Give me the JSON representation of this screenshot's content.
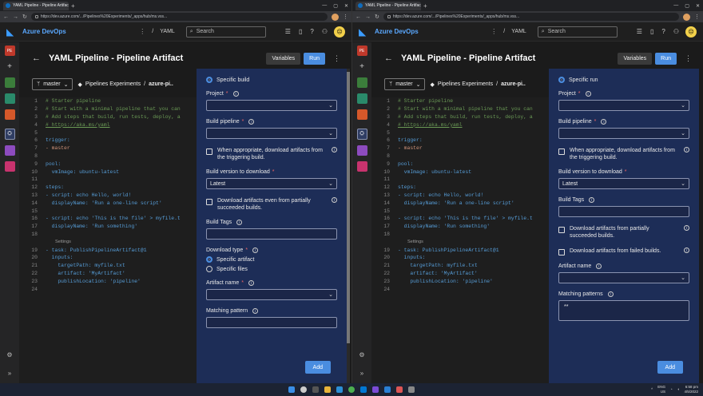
{
  "browser": {
    "tab_title": "YAML Pipeline - Pipeline Artifac",
    "url": "https://dev.azure.com/.../Pipelines%20Experiments/_apps/hub/ms.vss..."
  },
  "header": {
    "brand": "Azure DevOps",
    "crumb": "YAML",
    "search_placeholder": "Search",
    "avatar": "☹"
  },
  "rail": {
    "project_initials": "PE"
  },
  "page": {
    "title": "YAML Pipeline - Pipeline Artifact",
    "variables_label": "Variables",
    "run_label": "Run",
    "branch": "master",
    "repo_project": "Pipelines Experiments",
    "repo_file": "azure-pi.."
  },
  "editor": {
    "lines": [
      {
        "n": "1",
        "t": "# Starter pipeline",
        "k": "com"
      },
      {
        "n": "2",
        "t": "# Start with a minimal pipeline that you can",
        "k": "com"
      },
      {
        "n": "3",
        "t": "# Add steps that build, run tests, deploy, a",
        "k": "com"
      },
      {
        "n": "4",
        "t": "# https://aka.ms/yaml",
        "k": "link"
      },
      {
        "n": "5",
        "t": "",
        "k": "val"
      },
      {
        "n": "6",
        "t": "trigger:",
        "k": "key"
      },
      {
        "n": "7",
        "t": "- master",
        "k": "str"
      },
      {
        "n": "8",
        "t": "",
        "k": "val"
      },
      {
        "n": "9",
        "t": "pool:",
        "k": "key"
      },
      {
        "n": "10",
        "t": "  vmImage: ubuntu-latest",
        "k": "key"
      },
      {
        "n": "11",
        "t": "",
        "k": "val"
      },
      {
        "n": "12",
        "t": "steps:",
        "k": "key"
      },
      {
        "n": "13",
        "t": "- script: echo Hello, world!",
        "k": "key"
      },
      {
        "n": "14",
        "t": "  displayName: 'Run a one-line script'",
        "k": "key"
      },
      {
        "n": "15",
        "t": "",
        "k": "val"
      },
      {
        "n": "16",
        "t": "- script: echo 'This is the file' > myfile.t",
        "k": "key"
      },
      {
        "n": "17",
        "t": "  displayName: 'Run something'",
        "k": "key"
      },
      {
        "n": "18",
        "t": "",
        "k": "val"
      },
      {
        "n": "",
        "t": "Settings",
        "k": "lens"
      },
      {
        "n": "19",
        "t": "- task: PublishPipelineArtifact@1",
        "k": "key"
      },
      {
        "n": "20",
        "t": "  inputs:",
        "k": "key"
      },
      {
        "n": "21",
        "t": "    targetPath: myfile.txt",
        "k": "key"
      },
      {
        "n": "22",
        "t": "    artifact: 'MyArtifact'",
        "k": "key"
      },
      {
        "n": "23",
        "t": "    publishLocation: 'pipeline'",
        "k": "key"
      },
      {
        "n": "24",
        "t": "",
        "k": "val"
      }
    ]
  },
  "left_panel": {
    "top_radio": "Specific build",
    "project_label": "Project",
    "build_pipeline_label": "Build pipeline",
    "chk_trigger": "When appropriate, download artifacts from the triggering build.",
    "build_version_label": "Build version to download",
    "build_version_value": "Latest",
    "chk_partial": "Download artifacts even from partially succeeded builds.",
    "build_tags_label": "Build Tags",
    "download_type_label": "Download type",
    "radio_specific_artifact": "Specific artifact",
    "radio_specific_files": "Specific files",
    "artifact_name_label": "Artifact name",
    "matching_pattern_label": "Matching pattern",
    "add_label": "Add"
  },
  "right_panel": {
    "top_radio": "Specific run",
    "project_label": "Project",
    "build_pipeline_label": "Build pipeline",
    "chk_trigger": "When appropriate, download artifacts from the triggering build.",
    "build_version_label": "Build version to download",
    "build_version_value": "Latest",
    "build_tags_label": "Build Tags",
    "chk_partial": "Download artifacts from partially succeeded builds.",
    "chk_failed": "Download artifacts from failed builds.",
    "artifact_name_label": "Artifact name",
    "matching_patterns_label": "Matching patterns",
    "matching_patterns_value": "**",
    "add_label": "Add"
  },
  "taskbar": {
    "lang": "ENG",
    "region": "US",
    "time": "6:58 pm",
    "date": "4/5/2022"
  }
}
